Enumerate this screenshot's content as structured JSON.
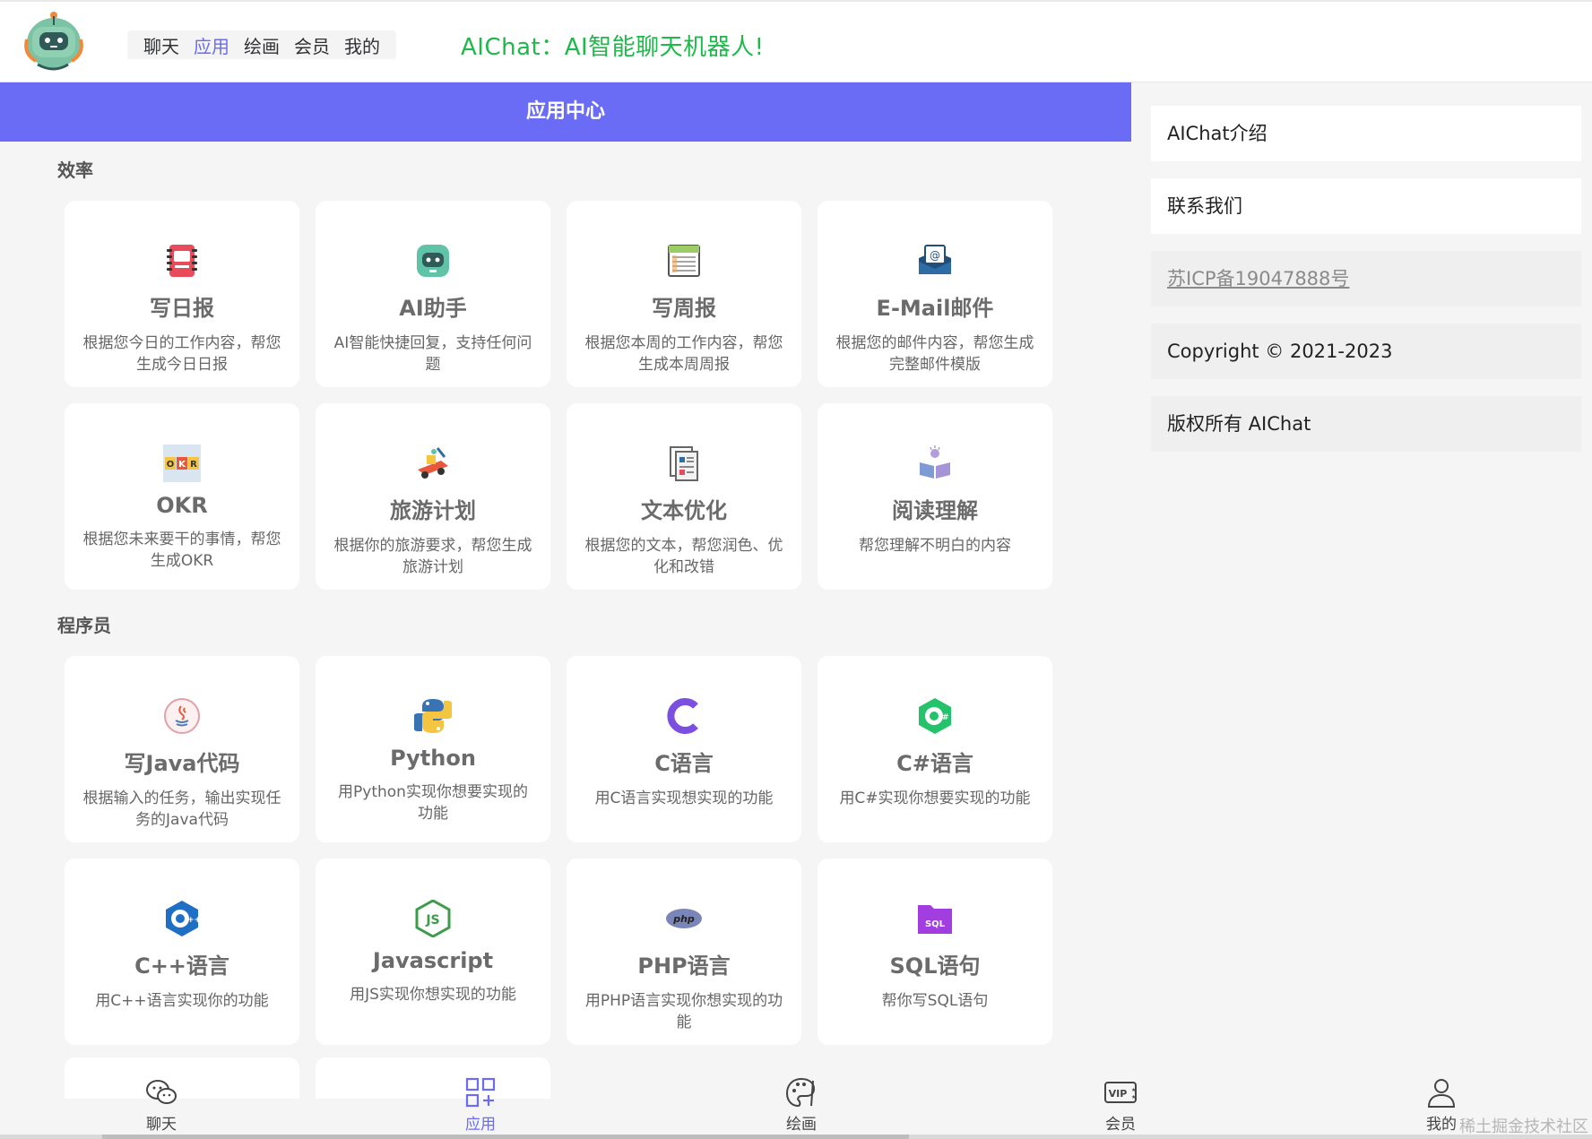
{
  "header": {
    "nav": [
      {
        "label": "聊天",
        "active": false
      },
      {
        "label": "应用",
        "active": true
      },
      {
        "label": "绘画",
        "active": false
      },
      {
        "label": "会员",
        "active": false
      },
      {
        "label": "我的",
        "active": false
      }
    ],
    "title": "AIChat：AI智能聊天机器人!"
  },
  "main": {
    "banner": "应用中心",
    "sections": [
      {
        "title": "效率",
        "cards": [
          {
            "icon": "notebook-icon",
            "title": "写日报",
            "desc": "根据您今日的工作内容，帮您生成今日日报"
          },
          {
            "icon": "robot-icon",
            "title": "AI助手",
            "desc": "AI智能快捷回复，支持任何问题"
          },
          {
            "icon": "weekly-calendar-icon",
            "title": "写周报",
            "desc": "根据您本周的工作内容，帮您生成本周周报"
          },
          {
            "icon": "email-icon",
            "title": "E-Mail邮件",
            "desc": "根据您的邮件内容，帮您生成完整邮件模版"
          },
          {
            "icon": "okr-icon",
            "title": "OKR",
            "desc": "根据您未来要干的事情，帮您生成OKR"
          },
          {
            "icon": "travel-icon",
            "title": "旅游计划",
            "desc": "根据你的旅游要求，帮您生成旅游计划"
          },
          {
            "icon": "document-icon",
            "title": "文本优化",
            "desc": "根据您的文本，帮您润色、优化和改错"
          },
          {
            "icon": "reading-icon",
            "title": "阅读理解",
            "desc": "帮您理解不明白的内容"
          }
        ]
      },
      {
        "title": "程序员",
        "cards": [
          {
            "icon": "java-icon",
            "title": "写Java代码",
            "desc": "根据输入的任务，输出实现任务的Java代码"
          },
          {
            "icon": "python-icon",
            "title": "Python",
            "desc": "用Python实现你想要实现的功能"
          },
          {
            "icon": "c-language-icon",
            "title": "C语言",
            "desc": "用C语言实现想实现的功能"
          },
          {
            "icon": "csharp-icon",
            "title": "C#语言",
            "desc": "用C#实现你想要实现的功能"
          },
          {
            "icon": "cpp-icon",
            "title": "C++语言",
            "desc": "用C++语言实现你的功能"
          },
          {
            "icon": "javascript-icon",
            "title": "Javascript",
            "desc": "用JS实现你想实现的功能"
          },
          {
            "icon": "php-icon",
            "title": "PHP语言",
            "desc": "用PHP语言实现你想实现的功能"
          },
          {
            "icon": "sql-icon",
            "title": "SQL语句",
            "desc": "帮你写SQL语句"
          }
        ]
      }
    ]
  },
  "sidebar": {
    "items": [
      {
        "label": "AIChat介绍"
      },
      {
        "label": "联系我们"
      },
      {
        "label": "苏ICP备19047888号"
      },
      {
        "label": "Copyright © 2021-2023"
      },
      {
        "label": "版权所有 AIChat"
      }
    ]
  },
  "tabbar": {
    "tabs": [
      {
        "icon": "wechat-icon",
        "label": "聊天",
        "active": false
      },
      {
        "icon": "apps-grid-icon",
        "label": "应用",
        "active": true
      },
      {
        "icon": "palette-icon",
        "label": "绘画",
        "active": false
      },
      {
        "icon": "vip-icon",
        "label": "会员",
        "active": false
      },
      {
        "icon": "user-icon",
        "label": "我的",
        "active": false
      }
    ]
  },
  "watermark": "稀土掘金技术社区",
  "colors": {
    "accent": "#6b6cf6",
    "brand_green": "#1fb84a",
    "active_text": "#6c6cf0"
  }
}
